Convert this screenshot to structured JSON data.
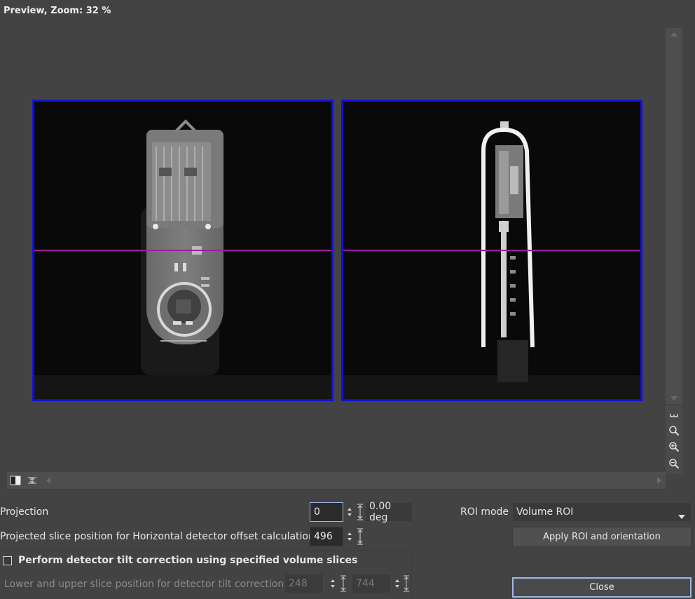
{
  "preview": {
    "title": "Preview, Zoom: 32 %"
  },
  "controls": {
    "projection_label": "Projection",
    "projection_value": "0",
    "angle_value": "0.00 deg",
    "roi_mode_label": "ROI mode",
    "roi_mode_value": "Volume ROI",
    "offset_label": "Projected slice position for Horizontal detector offset calculation",
    "offset_value": "496",
    "apply_label": "Apply ROI and orientation",
    "tilt_checkbox_label": "Perform detector tilt correction using specified volume slices",
    "tilt_checked": false,
    "tilt_range_label": "Lower and upper slice position for detector tilt correction",
    "tilt_lower": "248",
    "tilt_upper": "744",
    "close_label": "Close"
  },
  "icons": {
    "tools": [
      "fit-width-icon",
      "zoom-icon",
      "zoom-in-icon",
      "zoom-out-icon"
    ],
    "view": [
      "contrast-icon",
      "expand-icon"
    ]
  },
  "colors": {
    "panel_border": "#1010dd",
    "slice_line": "#9a1fa0",
    "close_border": "#9bb7e8"
  }
}
